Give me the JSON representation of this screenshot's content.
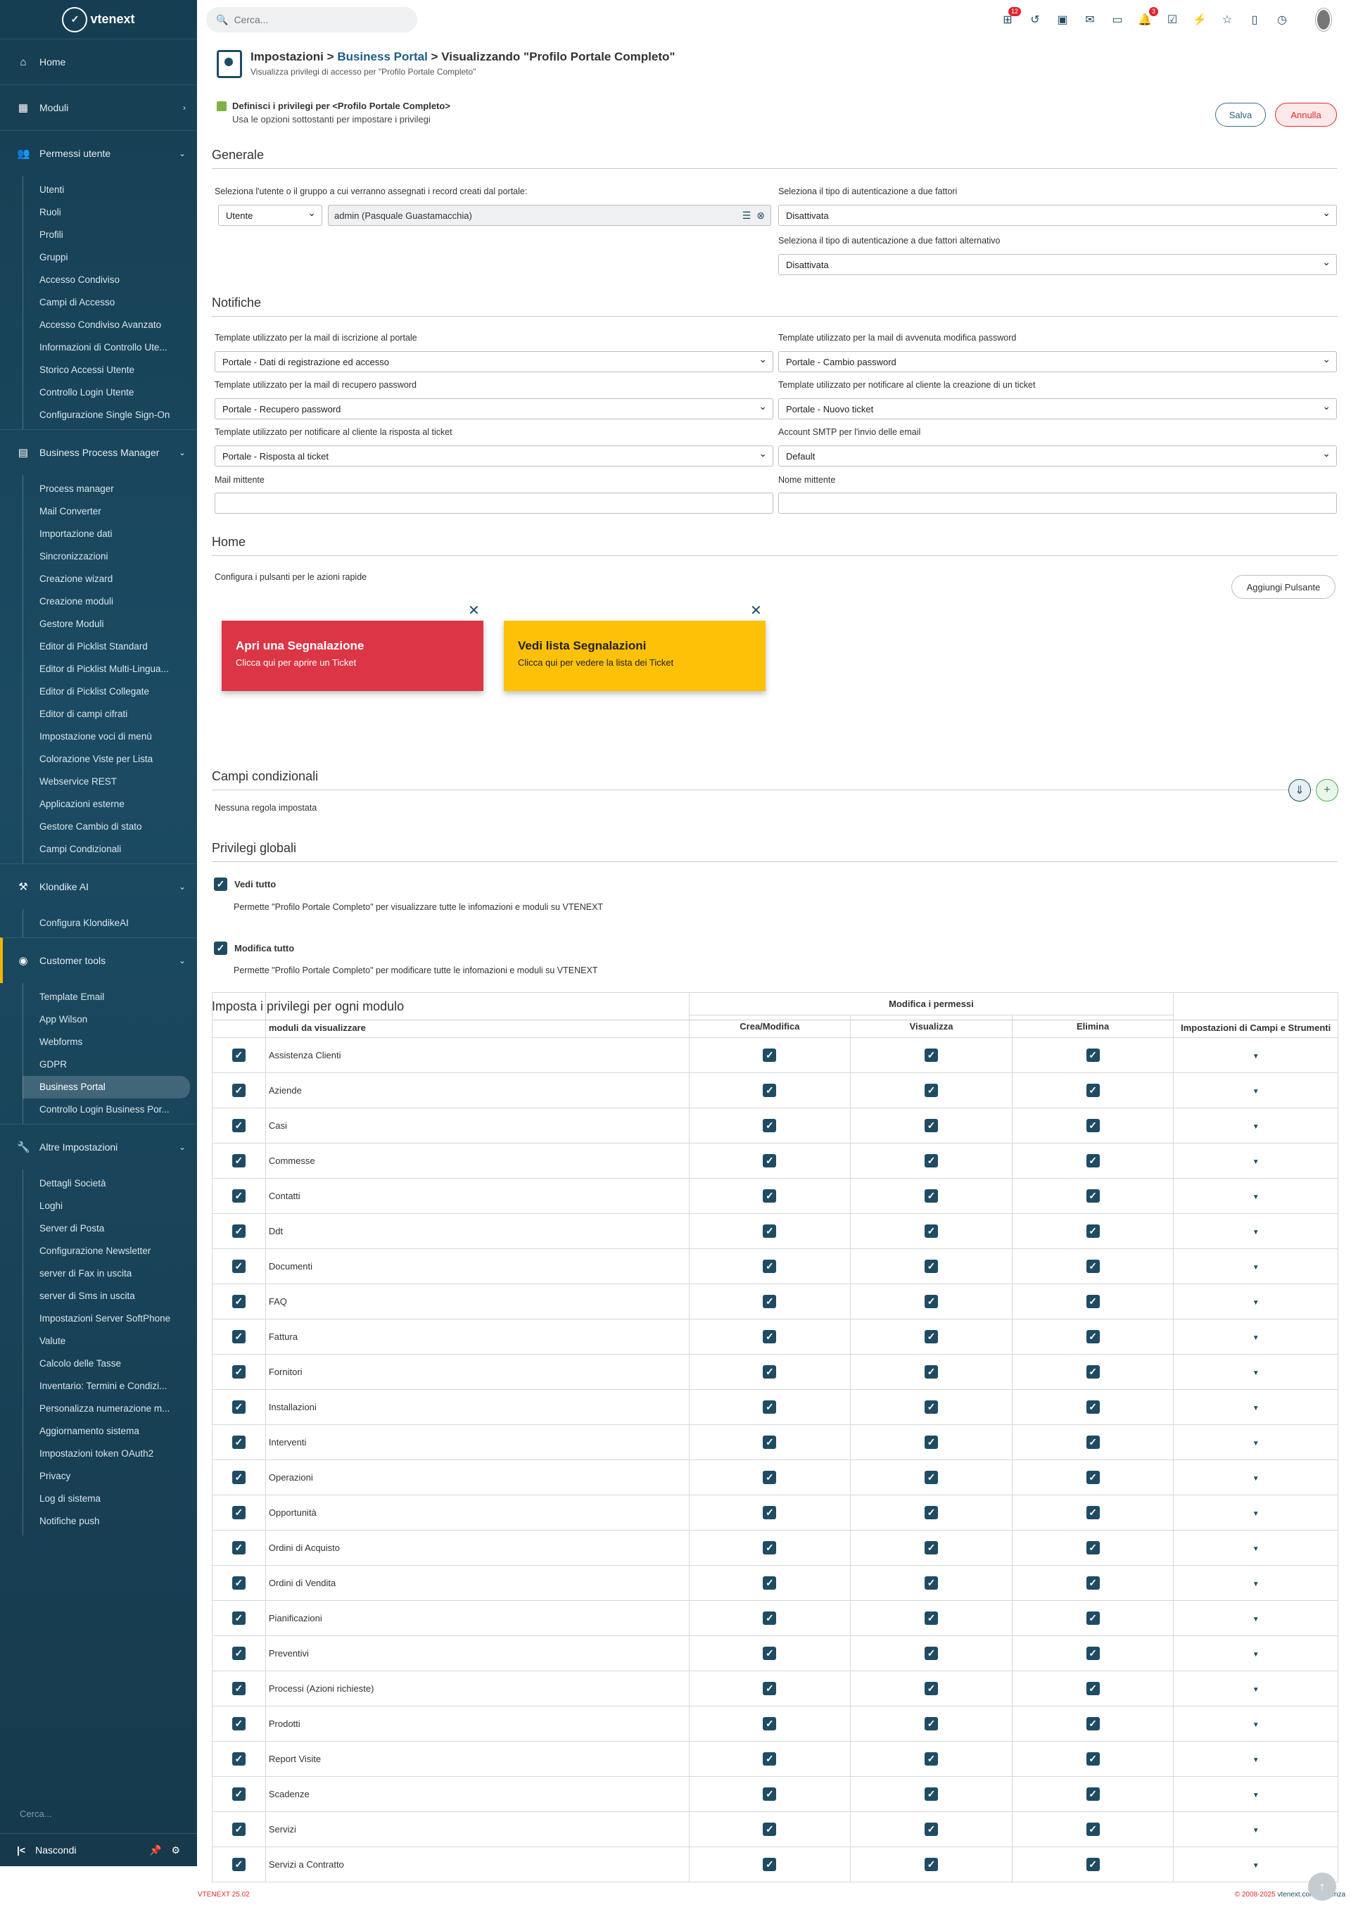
{
  "app": {
    "logo_text": "vtenext"
  },
  "topbar": {
    "search_placeholder": "Cerca...",
    "badge_first": "12",
    "badge_bell": "3"
  },
  "sidebar": {
    "home": "Home",
    "moduli": "Moduli",
    "permessi": "Permessi utente",
    "permessi_items": [
      "Utenti",
      "Ruoli",
      "Profili",
      "Gruppi",
      "Accesso Condiviso",
      "Campi di Accesso",
      "Accesso Condiviso Avanzato",
      "Informazioni di Controllo Ute...",
      "Storico Accessi Utente",
      "Controllo Login Utente",
      "Configurazione Single Sign-On"
    ],
    "bpm": "Business Process Manager",
    "bpm_items": [
      "Process manager",
      "Mail Converter",
      "Importazione dati",
      "Sincronizzazioni",
      "Creazione wizard",
      "Creazione moduli",
      "Gestore Moduli",
      "Editor di Picklist Standard",
      "Editor di Picklist Multi-Lingua...",
      "Editor di Picklist Collegate",
      "Editor di campi cifrati",
      "Impostazione voci di menù",
      "Colorazione Viste per Lista",
      "Webservice REST",
      "Applicazioni esterne",
      "Gestore Cambio di stato",
      "Campi Condizionali"
    ],
    "klondike": "Klondike AI",
    "klondike_items": [
      "Configura KlondikeAI"
    ],
    "customer": "Customer tools",
    "customer_items": [
      "Template Email",
      "App Wilson",
      "Webforms",
      "GDPR",
      "Business Portal",
      "Controllo Login Business Por..."
    ],
    "altre": "Altre Impostazioni",
    "altre_items": [
      "Dettagli Società",
      "Loghi",
      "Server di Posta",
      "Configurazione Newsletter",
      "server di Fax in uscita",
      "server di Sms in uscita",
      "Impostazioni Server SoftPhone",
      "Valute",
      "Calcolo delle Tasse",
      "Inventario: Termini e Condizi...",
      "Personalizza numerazione m...",
      "Aggiornamento sistema",
      "Impostazioni token OAuth2",
      "Privacy",
      "Log di sistema",
      "Notifiche push"
    ],
    "search_placeholder": "Cerca...",
    "hide_label": "Nascondi"
  },
  "header": {
    "crumb_settings": "Impostazioni",
    "sep": ">",
    "crumb_portal": "Business Portal",
    "crumb_current": "Visualizzando \"Profilo Portale Completo\"",
    "subtitle": "Visualizza privilegi di accesso per \"Profilo Portale Completo\""
  },
  "define": {
    "title": "Definisci i privilegi per <Profilo Portale Completo>",
    "hint": "Usa le opzioni sottostanti per impostare i privilegi"
  },
  "buttons": {
    "save": "Salva",
    "cancel": "Annulla"
  },
  "generale": {
    "title": "Generale",
    "assign_label": "Seleziona l'utente o il gruppo a cui verranno assegnati i record creati dal portale:",
    "assign_type": "Utente",
    "assign_user": "admin (Pasquale Guastamacchia)",
    "twofa_label": "Seleziona il tipo di autenticazione a due fattori",
    "twofa_value": "Disattivata",
    "twofa_alt_label": "Seleziona il tipo di autenticazione a due fattori alternativo",
    "twofa_alt_value": "Disattivata"
  },
  "notifiche": {
    "title": "Notifiche",
    "f1_label": "Template utilizzato per la mail di iscrizione al portale",
    "f1_value": "Portale - Dati di registrazione ed accesso",
    "f2_label": "Template utilizzato per la mail di avvenuta modifica password",
    "f2_value": "Portale - Cambio password",
    "f3_label": "Template utilizzato per la mail di recupero password",
    "f3_value": "Portale - Recupero password",
    "f4_label": "Template utilizzato per notificare al cliente la creazione di un ticket",
    "f4_value": "Portale - Nuovo ticket",
    "f5_label": "Template utilizzato per notificare al cliente la risposta al ticket",
    "f5_value": "Portale - Risposta al ticket",
    "f6_label": "Account SMTP per l'invio delle email",
    "f6_value": "Default",
    "f7_label": "Mail mittente",
    "f8_label": "Nome mittente"
  },
  "home": {
    "title": "Home",
    "desc": "Configura i pulsanti per le azioni rapide",
    "add_button": "Aggiungi Pulsante",
    "card1_title": "Apri una Segnalazione",
    "card1_sub": "Clicca qui per aprire un Ticket",
    "card1_color": "#dc3545",
    "card2_title": "Vedi lista Segnalazioni",
    "card2_sub": "Clicca qui per vedere la lista dei Ticket",
    "card2_color": "#ffc107"
  },
  "campi": {
    "title": "Campi condizionali",
    "empty": "Nessuna regola impostata"
  },
  "globali": {
    "title": "Privilegi globali",
    "view_all": "Vedi tutto",
    "view_all_desc": "Permette \"Profilo Portale Completo\" per visualizzare tutte le infomazioni e moduli su VTENEXT",
    "edit_all": "Modifica tutto",
    "edit_all_desc": "Permette \"Profilo Portale Completo\" per modificare tutte le infomazioni e moduli su VTENEXT"
  },
  "moduli_priv": {
    "title": "Imposta i privilegi per ogni modulo",
    "group_header": "Modifica i permessi",
    "col_module": "moduli da visualizzare",
    "col_create": "Crea/Modifica",
    "col_view": "Visualizza",
    "col_delete": "Elimina",
    "col_tools": "Impostazioni di Campi e Strumenti",
    "rows": [
      "Assistenza Clienti",
      "Aziende",
      "Casi",
      "Commesse",
      "Contatti",
      "Ddt",
      "Documenti",
      "FAQ",
      "Fattura",
      "Fornitori",
      "Installazioni",
      "Interventi",
      "Operazioni",
      "Opportunità",
      "Ordini di Acquisto",
      "Ordini di Vendita",
      "Pianificazioni",
      "Preventivi",
      "Processi (Azioni richieste)",
      "Prodotti",
      "Report Visite",
      "Scadenze",
      "Servizi",
      "Servizi a Contratto"
    ]
  },
  "footer": {
    "version": "VTENEXT 25.02",
    "copyright": "© 2008-2025",
    "site": "vtenext.com",
    "license_sep": "|",
    "license": "Licenza"
  }
}
